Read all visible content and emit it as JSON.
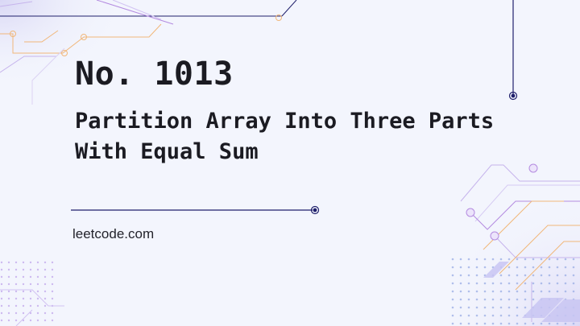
{
  "problem": {
    "number_label": "No. 1013",
    "title": "Partition Array Into Three Parts With Equal Sum"
  },
  "site": {
    "url": "leetcode.com"
  },
  "colors": {
    "background": "#f3f5fd",
    "text": "#1b1b22",
    "accent_navy": "#1f1f6b",
    "accent_purple": "#b48be0",
    "accent_orange": "#f1b77a"
  }
}
